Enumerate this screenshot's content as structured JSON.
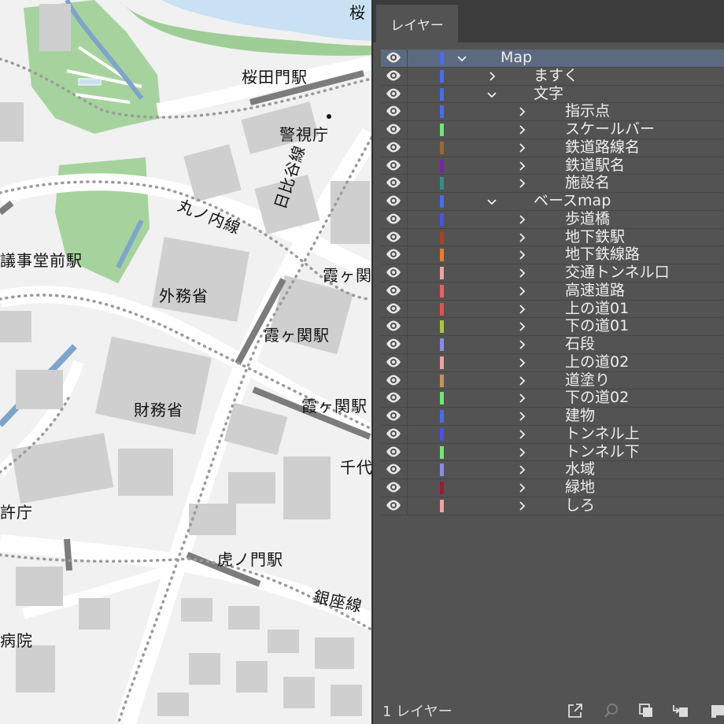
{
  "map": {
    "labels": {
      "sakura_top": "桜",
      "sakuradamon": "桜田門駅",
      "keishicho": "警視庁",
      "hibiya": "日比谷線",
      "marunouchi": "丸ノ内線",
      "gijido": "議事堂前駅",
      "gaimusho": "外務省",
      "kasumi_top": "霞ヶ関",
      "kasumigaseki": "霞ヶ関駅",
      "zaimusho": "財務省",
      "kasumi_right": "霞ヶ関駅",
      "chiyoda": "千代",
      "tokkyo": "許庁",
      "toranomon": "虎ノ門駅",
      "ginza": "銀座線",
      "byoin": "病院"
    }
  },
  "panel": {
    "tab_label": "レイヤー",
    "footer_count": "1 レイヤー",
    "footer_icons": [
      "export-icon",
      "search-icon",
      "collect-icon",
      "move-to-layer-icon",
      "new-layer-icon"
    ],
    "layers": [
      {
        "name": "Map",
        "color": "#4a6cf0",
        "expanded": true,
        "depth": 0,
        "selected": true
      },
      {
        "name": "ますく",
        "color": "#4a6cf0",
        "expanded": false,
        "depth": 1
      },
      {
        "name": "文字",
        "color": "#4a6cf0",
        "expanded": true,
        "depth": 1
      },
      {
        "name": "指示点",
        "color": "#4a6cf0",
        "expanded": false,
        "depth": 2
      },
      {
        "name": "スケールバー",
        "color": "#6fe86f",
        "expanded": false,
        "depth": 2
      },
      {
        "name": "鉄道路線名",
        "color": "#9a6a2e",
        "expanded": false,
        "depth": 2
      },
      {
        "name": "鉄道駅名",
        "color": "#7a22a8",
        "expanded": false,
        "depth": 2
      },
      {
        "name": "施設名",
        "color": "#2f8f8f",
        "expanded": false,
        "depth": 2
      },
      {
        "name": "ベースmap",
        "color": "#4a6cf0",
        "expanded": true,
        "depth": 1
      },
      {
        "name": "歩道橋",
        "color": "#4a52e8",
        "expanded": false,
        "depth": 2
      },
      {
        "name": "地下鉄駅",
        "color": "#a8421e",
        "expanded": false,
        "depth": 2
      },
      {
        "name": "地下鉄線路",
        "color": "#f07a2a",
        "expanded": false,
        "depth": 2
      },
      {
        "name": "交通トンネル口",
        "color": "#f0a0a0",
        "expanded": false,
        "depth": 2
      },
      {
        "name": "高速道路",
        "color": "#f06060",
        "expanded": false,
        "depth": 2
      },
      {
        "name": "上の道01",
        "color": "#e85050",
        "expanded": false,
        "depth": 2
      },
      {
        "name": "下の道01",
        "color": "#a8c83a",
        "expanded": false,
        "depth": 2
      },
      {
        "name": "石段",
        "color": "#8a8ae8",
        "expanded": false,
        "depth": 2
      },
      {
        "name": "上の道02",
        "color": "#f0a0a0",
        "expanded": false,
        "depth": 2
      },
      {
        "name": "道塗り",
        "color": "#c8905a",
        "expanded": false,
        "depth": 2
      },
      {
        "name": "下の道02",
        "color": "#6fe86f",
        "expanded": false,
        "depth": 2
      },
      {
        "name": "建物",
        "color": "#4a6cf0",
        "expanded": false,
        "depth": 2
      },
      {
        "name": "トンネル上",
        "color": "#4a52e8",
        "expanded": false,
        "depth": 2
      },
      {
        "name": "トンネル下",
        "color": "#6fe86f",
        "expanded": false,
        "depth": 2
      },
      {
        "name": "水域",
        "color": "#8a8ae8",
        "expanded": false,
        "depth": 2
      },
      {
        "name": "緑地",
        "color": "#a01830",
        "expanded": false,
        "depth": 2
      },
      {
        "name": "しろ",
        "color": "#f0a0a0",
        "expanded": false,
        "depth": 2
      }
    ]
  }
}
